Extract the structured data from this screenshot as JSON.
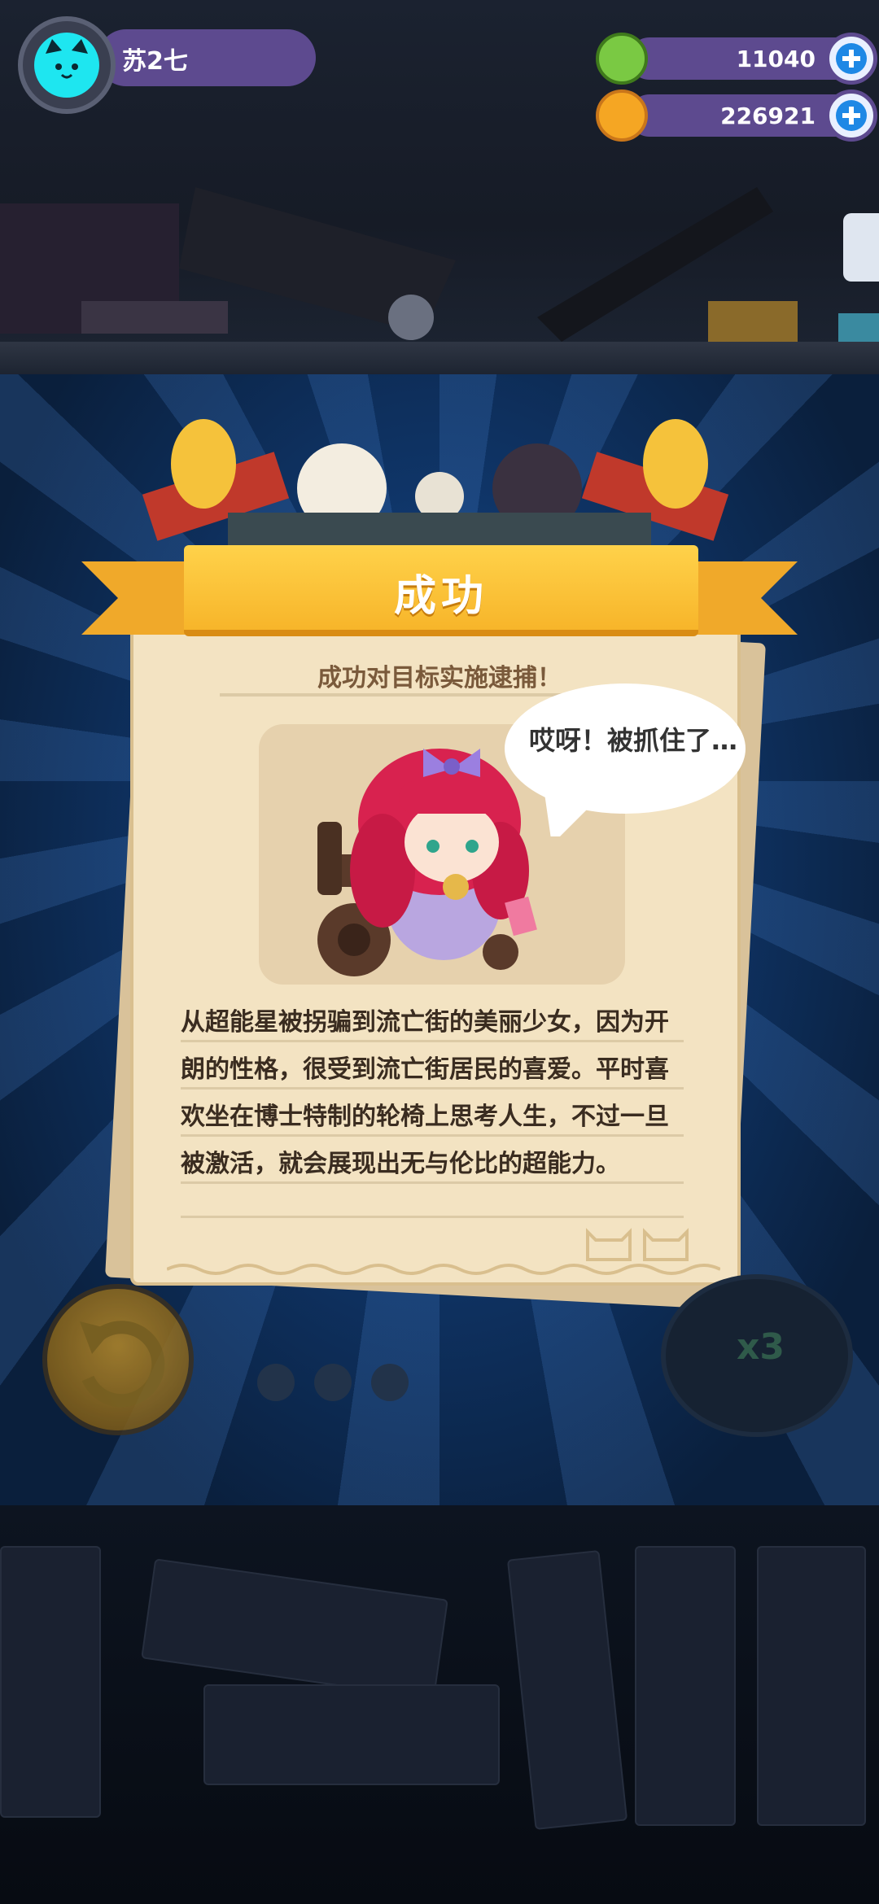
{
  "player": {
    "name": "苏2七"
  },
  "currencies": [
    {
      "name": "green-gem",
      "value": "11040",
      "color": "#7ac943"
    },
    {
      "name": "gold-coin",
      "value": "226921",
      "color": "#f5a623"
    }
  ],
  "result": {
    "title": "成功",
    "subtitle": "成功对目标实施逮捕！",
    "speech": "哎呀！被抓住了…",
    "description_lines": [
      "从超能星被拐骗到流亡街的美丽少女，因为开",
      "朗的性格，很受到流亡街居民的喜爱。平时喜",
      "欢坐在博士特制的轮椅上思考人生，不过一旦",
      "被激活，就会展现出无与伦比的超能力。"
    ]
  },
  "controls": {
    "speed_label": "x3"
  },
  "colors": {
    "ribbon": "#f7b52a",
    "paper": "#f3e3c2",
    "hud_bar": "#5d4a8f",
    "accent": "#1ee6f0"
  }
}
